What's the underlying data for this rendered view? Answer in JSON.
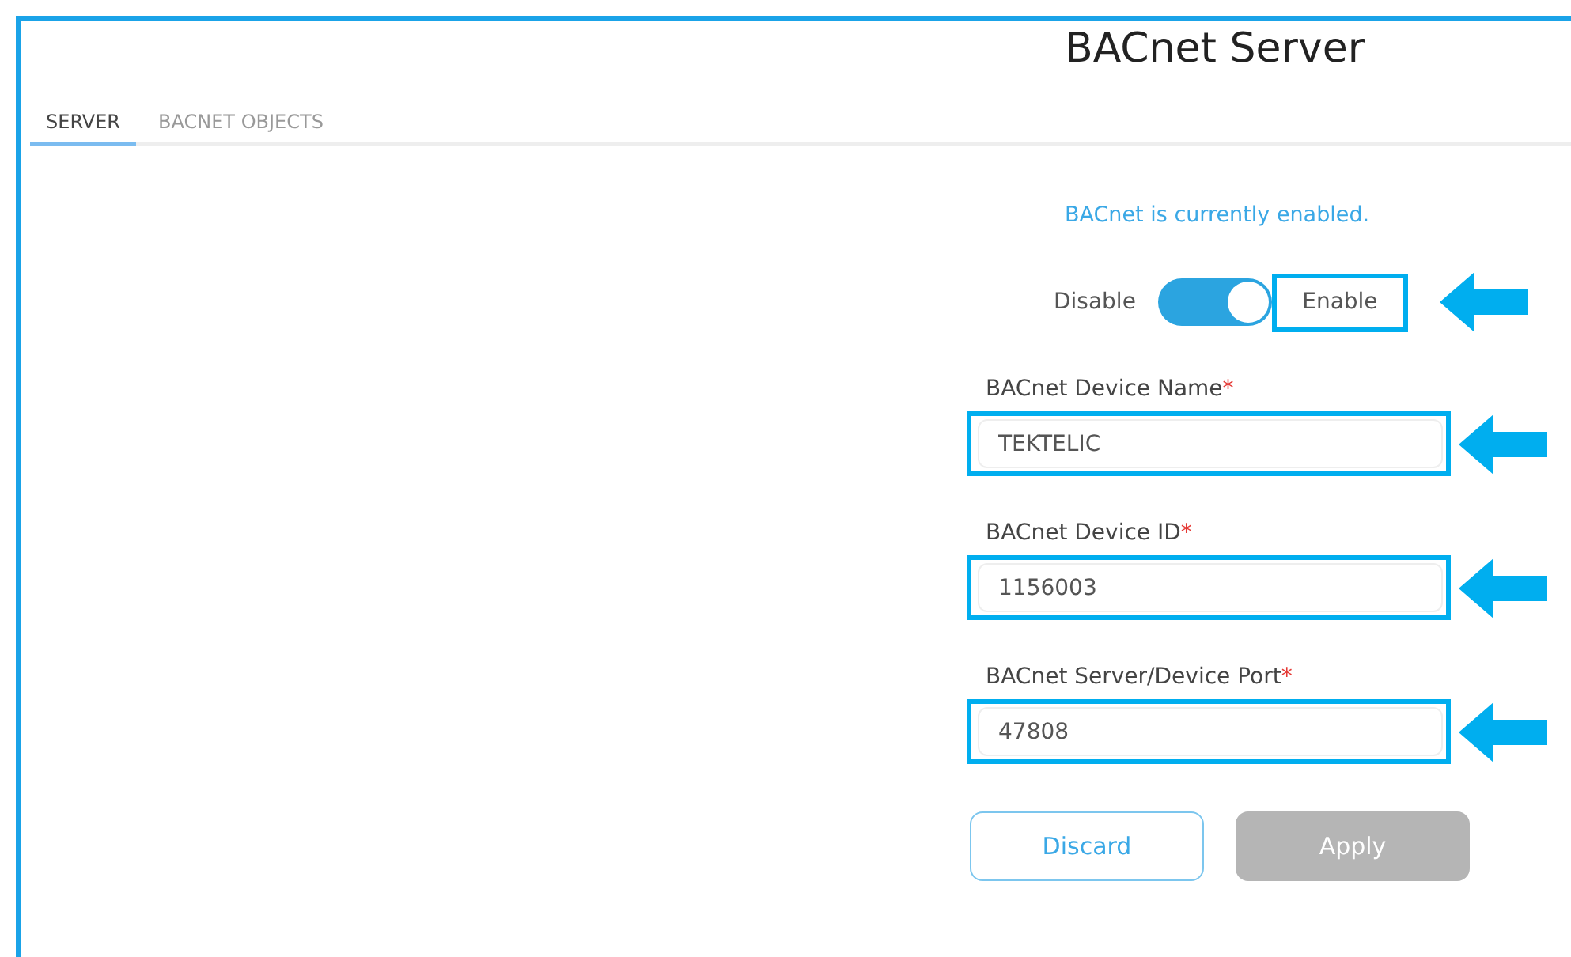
{
  "title": "BACnet Server",
  "tabs": [
    {
      "label": "SERVER",
      "selected": true
    },
    {
      "label": "BACNET OBJECTS",
      "selected": false
    }
  ],
  "status_message": "BACnet is currently enabled.",
  "toggle": {
    "off_label": "Disable",
    "on_label": "Enable",
    "on": true,
    "highlighted": true
  },
  "fields": [
    {
      "label": "BACnet Device Name",
      "required_mark": "*",
      "value": "TEKTELIC",
      "highlighted": true
    },
    {
      "label": "BACnet Device ID",
      "required_mark": "*",
      "value": "1156003",
      "highlighted": true
    },
    {
      "label": "BACnet Server/Device Port",
      "required_mark": "*",
      "value": "47808",
      "highlighted": true
    }
  ],
  "buttons": [
    {
      "label": "Discard",
      "kind": "secondary",
      "disabled": false
    },
    {
      "label": "Apply",
      "kind": "primary",
      "disabled": true
    }
  ]
}
